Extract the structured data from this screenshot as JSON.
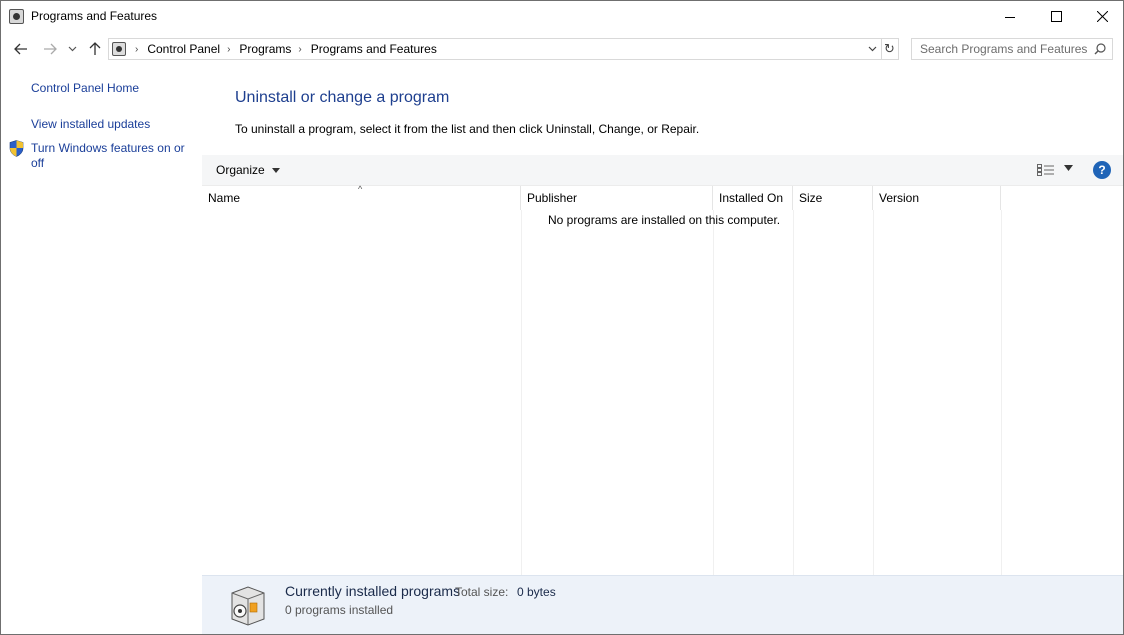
{
  "window": {
    "title": "Programs and Features"
  },
  "nav": {
    "breadcrumbs": [
      "Control Panel",
      "Programs",
      "Programs and Features"
    ],
    "search_placeholder": "Search Programs and Features"
  },
  "sidebar": {
    "home": "Control Panel Home",
    "updates": "View installed updates",
    "features": "Turn Windows features on or off"
  },
  "main": {
    "heading": "Uninstall or change a program",
    "description": "To uninstall a program, select it from the list and then click Uninstall, Change, or Repair."
  },
  "toolbar": {
    "organize": "Organize"
  },
  "columns": [
    "Name",
    "Publisher",
    "Installed On",
    "Size",
    "Version"
  ],
  "list": {
    "empty_message": "No programs are installed on this computer."
  },
  "details": {
    "title": "Currently installed programs",
    "total_size_label": "Total size:",
    "total_size_value": "0 bytes",
    "count": "0 programs installed"
  },
  "colors": {
    "link": "#1a3e99",
    "heading": "#1e3f8f",
    "help": "#1f64b7",
    "details_bg": "#edf2f9"
  }
}
